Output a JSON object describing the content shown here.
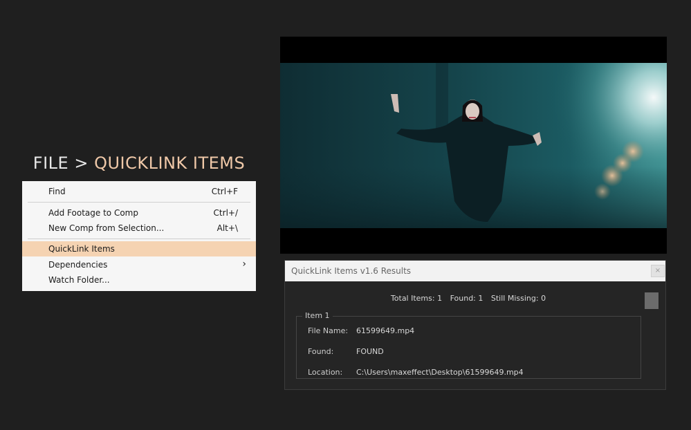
{
  "headline": {
    "prefix": "FILE > ",
    "accent": "QUICKLINK ITEMS"
  },
  "menu": {
    "items": [
      {
        "label": "Find",
        "shortcut": "Ctrl+F"
      },
      {
        "label": "Add Footage to Comp",
        "shortcut": "Ctrl+/"
      },
      {
        "label": "New Comp from Selection...",
        "shortcut": "Alt+\\"
      },
      {
        "label": "QuickLink Items",
        "shortcut": "",
        "highlighted": true
      },
      {
        "label": "Dependencies",
        "submenu_glyph": "›"
      },
      {
        "label": "Watch Folder...",
        "shortcut": ""
      }
    ]
  },
  "dialog": {
    "title": "QuickLink Items v1.6 Results",
    "close_glyph": "×",
    "summary": {
      "total": "Total Items: 1",
      "found": "Found: 1",
      "missing": "Still Missing: 0"
    },
    "item": {
      "legend": "Item 1",
      "file_name_label": "File Name:",
      "file_name_value": "61599649.mp4",
      "found_label": "Found:",
      "found_value": "FOUND",
      "location_label": "Location:",
      "location_value": "C:\\Users\\maxeffect\\Desktop\\61599649.mp4"
    }
  },
  "colors": {
    "accent": "#efc8a8",
    "menu_highlight": "#f5d3b2",
    "background": "#1f1f1f"
  }
}
